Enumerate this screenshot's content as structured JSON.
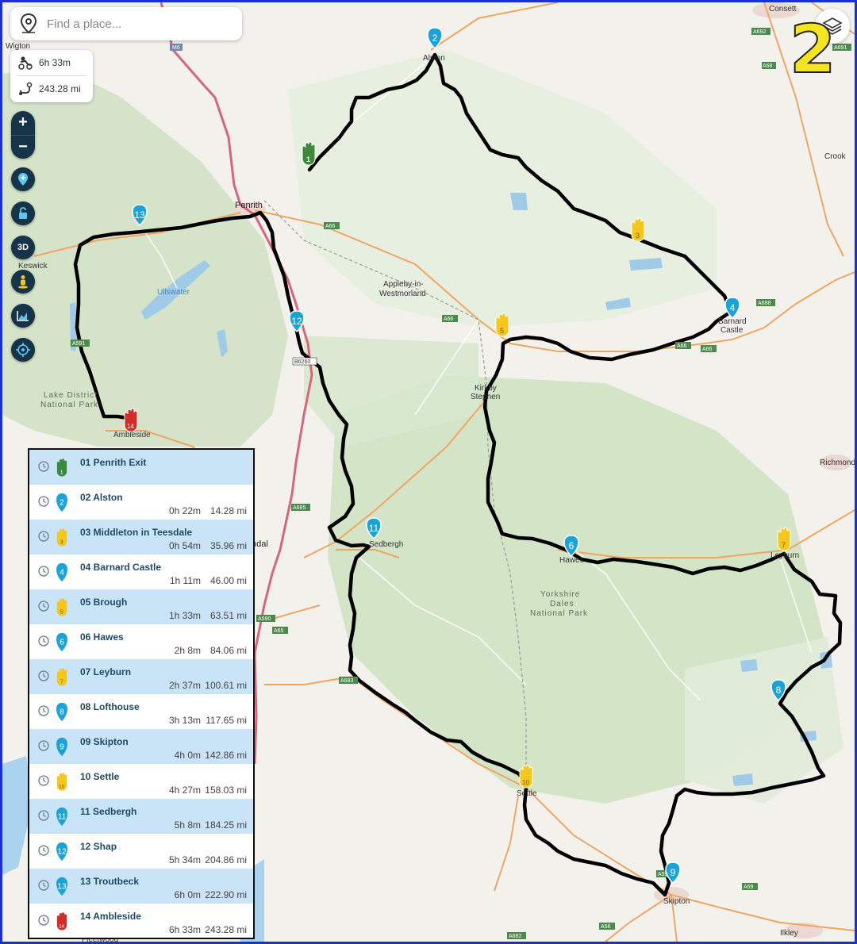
{
  "search": {
    "placeholder": "Find a place..."
  },
  "route_summary": {
    "duration": "6h 33m",
    "distance": "243.28 mi"
  },
  "map_controls": [
    "zoom-in",
    "zoom-out",
    "add-waypoint",
    "unlock",
    "3D",
    "pegman",
    "elevation-chart",
    "locate"
  ],
  "controls": {
    "zoom_in": "+",
    "zoom_out": "−",
    "btn_3d": "3D"
  },
  "overlay_label": "2",
  "colors": {
    "waypoint_blue": "#1aa3d9",
    "waypoint_yellow": "#f5c71a",
    "start_green": "#3a8a3a",
    "end_red": "#d32a2a",
    "route": "#000000",
    "list_alt_row": "#c9e4f6",
    "frame": "#1a2fd6"
  },
  "places": [
    {
      "name": "Wigton"
    },
    {
      "name": "Consett"
    },
    {
      "name": "Alston"
    },
    {
      "name": "Crook"
    },
    {
      "name": "Penrith"
    },
    {
      "name": "Keswick"
    },
    {
      "name": "Ullswater"
    },
    {
      "name": "Appleby-in-"
    },
    {
      "name": "Westmorland"
    },
    {
      "name": "Barnard"
    },
    {
      "name": "Castle"
    },
    {
      "name": "Lake District"
    },
    {
      "name": "National Park"
    },
    {
      "name": "Ambleside"
    },
    {
      "name": "Kirkby"
    },
    {
      "name": "Stephen"
    },
    {
      "name": "Richmond"
    },
    {
      "name": "Sedbergh"
    },
    {
      "name": "Hawes"
    },
    {
      "name": "Leyburn"
    },
    {
      "name": "Yorkshire"
    },
    {
      "name": "Dales"
    },
    {
      "name": "National Park"
    },
    {
      "name": "Settle"
    },
    {
      "name": "Skipton"
    },
    {
      "name": "Ilkley"
    },
    {
      "name": "Fleetwood"
    },
    {
      "name": "ndal"
    }
  ],
  "roads": [
    "M6",
    "A692",
    "A691",
    "A68",
    "A66",
    "A688",
    "A685",
    "A591",
    "B6260",
    "A684",
    "A590",
    "A65",
    "A683",
    "A59",
    "A682",
    "A56",
    "A629"
  ],
  "waypoints": [
    {
      "num": "1",
      "label": "01 Penrith Exit",
      "time": "",
      "distance": "",
      "kind": "start"
    },
    {
      "num": "2",
      "label": "02 Alston",
      "time": "0h 22m",
      "distance": "14.28 mi",
      "kind": "blue"
    },
    {
      "num": "3",
      "label": "03 Middleton in Teesdale",
      "time": "0h 54m",
      "distance": "35.96 mi",
      "kind": "yellow"
    },
    {
      "num": "4",
      "label": "04 Barnard Castle",
      "time": "1h 11m",
      "distance": "46.00 mi",
      "kind": "blue"
    },
    {
      "num": "5",
      "label": "05 Brough",
      "time": "1h 33m",
      "distance": "63.51 mi",
      "kind": "yellow"
    },
    {
      "num": "6",
      "label": "06 Hawes",
      "time": "2h 8m",
      "distance": "84.06 mi",
      "kind": "blue"
    },
    {
      "num": "7",
      "label": "07 Leyburn",
      "time": "2h 37m",
      "distance": "100.61 mi",
      "kind": "yellow"
    },
    {
      "num": "8",
      "label": "08 Lofthouse",
      "time": "3h 13m",
      "distance": "117.65 mi",
      "kind": "blue"
    },
    {
      "num": "9",
      "label": "09 Skipton",
      "time": "4h 0m",
      "distance": "142.86 mi",
      "kind": "blue"
    },
    {
      "num": "10",
      "label": "10 Settle",
      "time": "4h 27m",
      "distance": "158.03 mi",
      "kind": "yellow"
    },
    {
      "num": "11",
      "label": "11 Sedbergh",
      "time": "5h 8m",
      "distance": "184.25 mi",
      "kind": "blue"
    },
    {
      "num": "12",
      "label": "12 Shap",
      "time": "5h 34m",
      "distance": "204.86 mi",
      "kind": "blue"
    },
    {
      "num": "13",
      "label": "13 Troutbeck",
      "time": "6h 0m",
      "distance": "222.90 mi",
      "kind": "blue"
    },
    {
      "num": "14",
      "label": "14 Ambleside",
      "time": "6h 33m",
      "distance": "243.28 mi",
      "kind": "end"
    }
  ]
}
